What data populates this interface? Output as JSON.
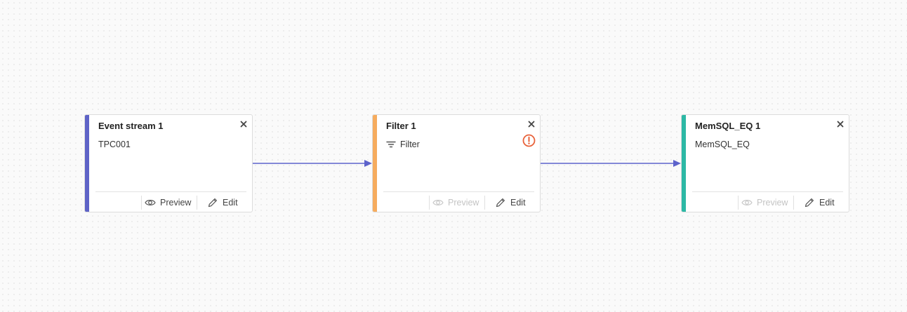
{
  "colors": {
    "event_stream_accent": "#5e63c7",
    "filter_accent": "#f6ac5e",
    "memsql_accent": "#2cb8a5",
    "connector": "#5d63cb",
    "warning": "#e8623a"
  },
  "nodes": [
    {
      "title": "Event stream 1",
      "subtitle": "TPC001",
      "preview_label": "Preview",
      "edit_label": "Edit",
      "preview_enabled": true
    },
    {
      "title": "Filter 1",
      "subtitle": "Filter",
      "type_icon": "filter-icon",
      "has_warning": true,
      "preview_label": "Preview",
      "edit_label": "Edit",
      "preview_enabled": false
    },
    {
      "title": "MemSQL_EQ 1",
      "subtitle": "MemSQL_EQ",
      "preview_label": "Preview",
      "edit_label": "Edit",
      "preview_enabled": false
    }
  ],
  "icons": {
    "close": "close-icon",
    "preview": "eye-icon",
    "edit": "pencil-icon",
    "warning": "exclamation-circle-icon"
  }
}
